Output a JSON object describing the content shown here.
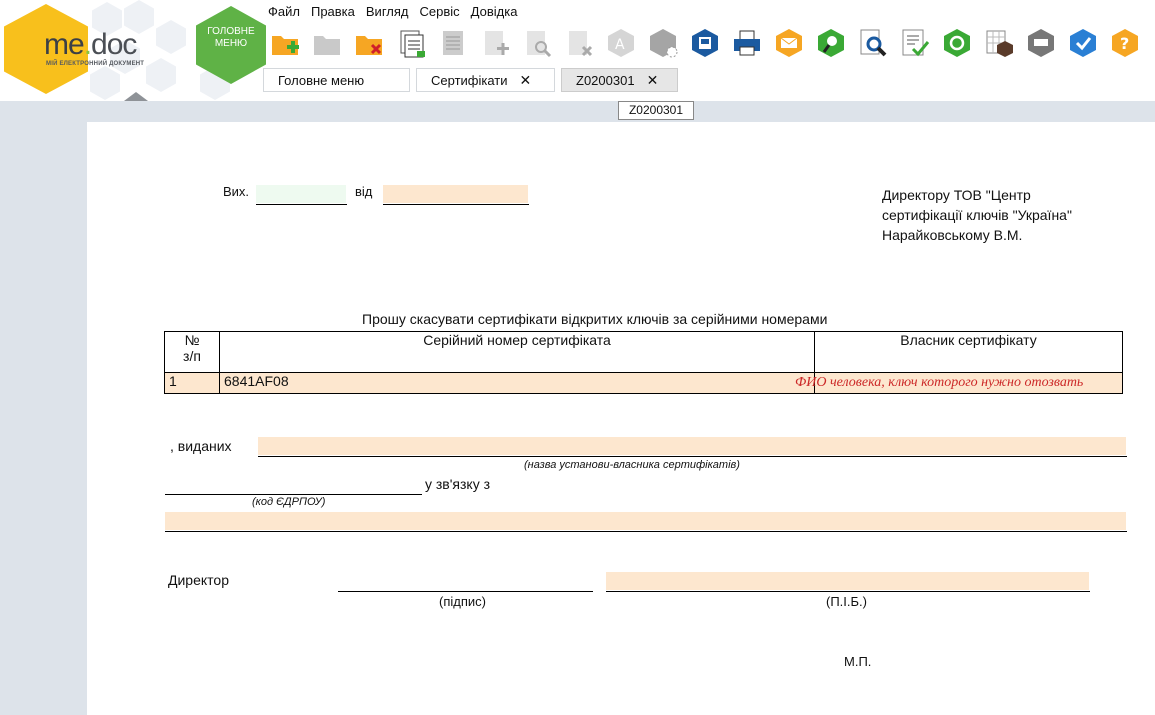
{
  "app": {
    "logo_text_me": "me",
    "logo_text_dot": ".",
    "logo_text_doc": "doc",
    "logo_subtitle": "МІЙ ЕЛЕКТРОННИЙ ДОКУМЕНТ",
    "main_menu_label_1": "ГОЛОВНЕ",
    "main_menu_label_2": "МЕНЮ"
  },
  "menu": [
    "Файл",
    "Правка",
    "Вигляд",
    "Сервіс",
    "Довідка"
  ],
  "toolbar_icons": [
    "new-folder-icon",
    "open-folder-icon",
    "delete-folder-icon",
    "copy-document-icon",
    "document-list-icon",
    "add-document-icon",
    "search-document-icon",
    "remove-document-icon",
    "font-icon",
    "settings-hex-icon",
    "save-disk-icon",
    "print-icon",
    "send-mail-icon",
    "find-key-icon",
    "zoom-search-icon",
    "sign-check-icon",
    "refresh-icon",
    "calculator-icon",
    "message-icon",
    "checkmark-icon",
    "help-icon"
  ],
  "tabs": [
    {
      "label": "Головне меню",
      "closable": false
    },
    {
      "label": "Сертифікати",
      "closable": true
    },
    {
      "label": "Z0200301",
      "closable": true,
      "active": true
    }
  ],
  "doc_label": "Z0200301",
  "form": {
    "out_label": "Вих.",
    "date_label": "від",
    "addressee_line1": "Директору ТОВ \"Центр",
    "addressee_line2": "сертифікації ключів \"Україна\"",
    "addressee_line3": "Нарайковському В.М.",
    "request_title": "Прошу скасувати сертифікати відкритих ключів за серійними номерами",
    "table_headers": {
      "num_1": "№",
      "num_2": "з/п",
      "serial": "Серійний номер сертифіката",
      "owner": "Власник сертифікату"
    },
    "rows": [
      {
        "num": "1",
        "serial": "6841AF08",
        "owner": "ФИО человека, ключ которого нужно отозвать"
      }
    ],
    "issued_label": ", виданих",
    "issued_caption": "(назва установи-власника сертифікатів)",
    "edrpou_caption": "(код ЄДРПОУ)",
    "reason_label": "у зв'язку з",
    "director_label": "Директор",
    "signature_caption": "(підпис)",
    "name_caption": "(П.І.Б.)",
    "stamp_label": "М.П."
  },
  "colors": {
    "field_fill": "#fde7cf",
    "field_green": "#eefaf0",
    "accent_green": "#5fb246",
    "logo_yellow": "#f8c01c",
    "owner_red": "#cc2828"
  }
}
